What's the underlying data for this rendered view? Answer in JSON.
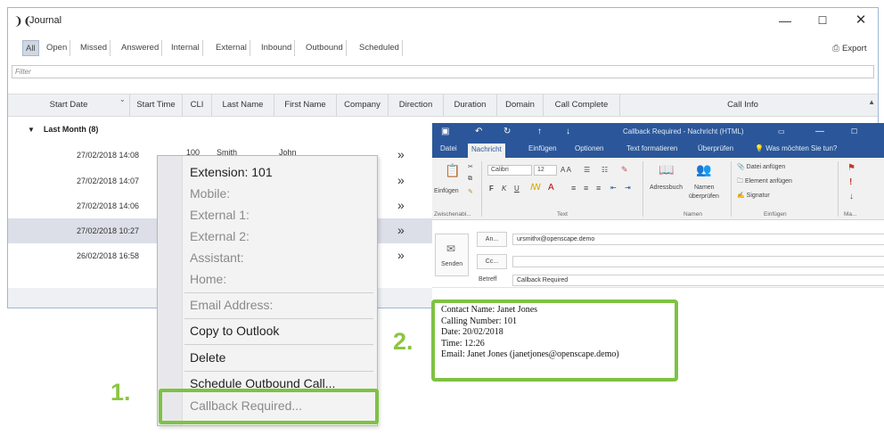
{
  "journal": {
    "title": "Journal",
    "window_controls": {
      "minimize": "—",
      "maximize": "☐",
      "close": "✕"
    },
    "tabs": [
      "All",
      "Open",
      "Missed",
      "Answered",
      "Internal",
      "External",
      "Inbound",
      "Outbound",
      "Scheduled"
    ],
    "export_label": "Export",
    "filter_placeholder": "Filter",
    "columns": [
      "Start Date",
      "Start Time",
      "CLI",
      "Last Name",
      "First Name",
      "Company",
      "Direction",
      "Duration",
      "Domain",
      "Call Complete",
      "Call Info"
    ],
    "group_label": "Last Month (8)",
    "rows": [
      {
        "date": "27/02/2018 14:08",
        "cli": "100",
        "last": "Smith",
        "first": "John",
        "selected": false
      },
      {
        "date": "27/02/2018 14:07",
        "cli": "",
        "last": "",
        "first": "",
        "selected": false
      },
      {
        "date": "27/02/2018 14:06",
        "cli": "",
        "last": "",
        "first": "",
        "selected": false
      },
      {
        "date": "27/02/2018 10:27",
        "cli": "",
        "last": "",
        "first": "",
        "selected": true
      },
      {
        "date": "26/02/2018 16:58",
        "cli": "",
        "last": "",
        "first": "",
        "selected": false
      }
    ]
  },
  "context_menu": {
    "items": [
      {
        "label": "Extension: 101",
        "enabled": true
      },
      {
        "label": "Mobile:",
        "enabled": false
      },
      {
        "label": "External 1:",
        "enabled": false
      },
      {
        "label": "External 2:",
        "enabled": false
      },
      {
        "label": "Assistant:",
        "enabled": false
      },
      {
        "label": "Home:",
        "enabled": false
      },
      {
        "label": "Email Address:",
        "enabled": false
      },
      {
        "label": "Copy to Outlook",
        "enabled": true
      },
      {
        "label": "Delete",
        "enabled": true
      },
      {
        "label": "Schedule Outbound Call...",
        "enabled": true
      },
      {
        "label": "Callback Required...",
        "enabled": false
      }
    ]
  },
  "steps": {
    "one": "1.",
    "two": "2."
  },
  "outlook": {
    "title": "Callback Required - Nachricht (HTML)",
    "tabs": [
      "Datei",
      "Nachricht",
      "Einfügen",
      "Optionen",
      "Text formatieren",
      "Überprüfen",
      "Was möchten Sie tun?"
    ],
    "ribbon": {
      "paste": "Einfügen",
      "clipboard": "Zwischenabl...",
      "font": "Calibri",
      "font_size": "12",
      "text_group": "Text",
      "address_book": "Adressbuch",
      "check_names_1": "Namen",
      "check_names_2": "überprüfen",
      "names_group": "Namen",
      "attach_file": "Datei anfügen",
      "attach_item": "Element anfügen",
      "signature": "Signatur",
      "include_group": "Einfügen",
      "tags_group": "Ma..."
    },
    "send_label": "Senden",
    "to_label": "An...",
    "cc_label": "Cc...",
    "subject_label": "Betreff",
    "to_value": "ursmithx@openscape.demo",
    "cc_value": "",
    "subject_value": "Callback Required",
    "body_lines": [
      "Contact Name: Janet Jones",
      "Calling Number: 101",
      "Date: 20/02/2018",
      "Time: 12:26",
      "Email: Janet Jones (janetjones@openscape.demo)"
    ]
  }
}
